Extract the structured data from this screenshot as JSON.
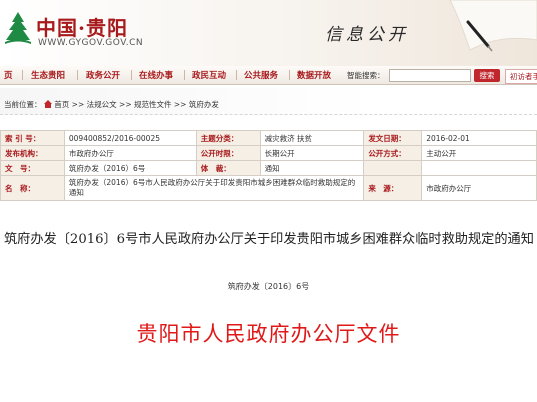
{
  "header": {
    "site_name": "中国·贵阳",
    "site_url": "WWW.GYGOV.GOV.CN",
    "section_title": "信息公开"
  },
  "nav": {
    "items": [
      "页",
      "生态贵阳",
      "政务公开",
      "在线办事",
      "政民互动",
      "公共服务",
      "数据开放"
    ],
    "search_label": "智能搜索：",
    "search_placeholder": "",
    "search_button": "搜索",
    "lang_button": "初访者手"
  },
  "breadcrumb": {
    "label": "当前位置：",
    "items": [
      "首页",
      "法规公文",
      "规范性文件",
      "筑府办发"
    ],
    "sep": ">>"
  },
  "meta": {
    "rows": [
      [
        {
          "k": "索 引 号：",
          "v": "009400852/2016-00025"
        },
        {
          "k": "主题分类：",
          "v": "减灾救济 扶贫"
        },
        {
          "k": "发文日期：",
          "v": "2016-02-01"
        }
      ],
      [
        {
          "k": "发布机构：",
          "v": "市政府办公厅"
        },
        {
          "k": "公开时限：",
          "v": "长期公开"
        },
        {
          "k": "公开方式：",
          "v": "主动公开"
        }
      ],
      [
        {
          "k": "文　号：",
          "v": "筑府办发（2016）6号"
        },
        {
          "k": "体　裁：",
          "v": "通知"
        },
        {
          "k": "",
          "v": ""
        }
      ],
      [
        {
          "k": "名　称：",
          "v": "筑府办发（2016）6号市人民政府办公厅关于印发贵阳市城乡困难群众临时救助规定的通知"
        },
        {
          "k": "来　源：",
          "v": "市政府办公厅"
        }
      ]
    ]
  },
  "document": {
    "title": "筑府办发〔2016〕6号市人民政府办公厅关于印发贵阳市城乡困难群众临时救助规定的通知",
    "doc_number": "筑府办发〔2016〕6号",
    "red_header": "贵阳市人民政府办公厅文件"
  },
  "colors": {
    "brand_red": "#a8191c",
    "header_red": "#e01818",
    "search_button": "#c0272d"
  }
}
